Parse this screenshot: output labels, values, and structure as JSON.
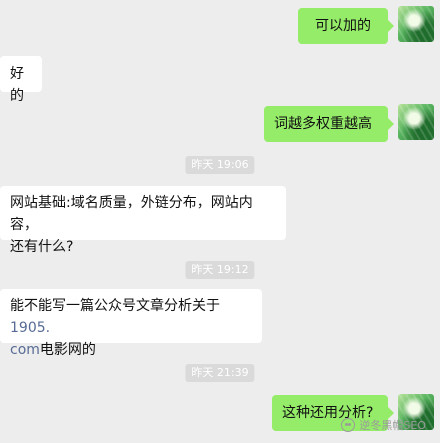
{
  "messages": [
    {
      "side": "out",
      "text": "可以加的"
    },
    {
      "side": "in",
      "text": "好的"
    },
    {
      "side": "out",
      "text": "词越多权重越高"
    },
    {
      "type": "time",
      "text": "昨天 19:06"
    },
    {
      "side": "in",
      "line1": "网站基础:域名质量，外链分布，网站内容，",
      "line2": "还有什么?"
    },
    {
      "type": "time",
      "text": "昨天 19:12"
    },
    {
      "side": "in",
      "line1_prefix": "能不能写一篇公众号文章分析关于",
      "line1_link": "1905.",
      "line2_link": "com",
      "line2_suffix": "电影网的"
    },
    {
      "type": "time",
      "text": "昨天 21:39"
    },
    {
      "side": "out",
      "text": "这种还用分析?"
    }
  ],
  "watermark": {
    "text": "逆冬黑帽SEO"
  },
  "colors": {
    "sent_bubble": "#95ec69",
    "received_bubble": "#ffffff",
    "background": "#ededed",
    "link": "#576b95"
  }
}
